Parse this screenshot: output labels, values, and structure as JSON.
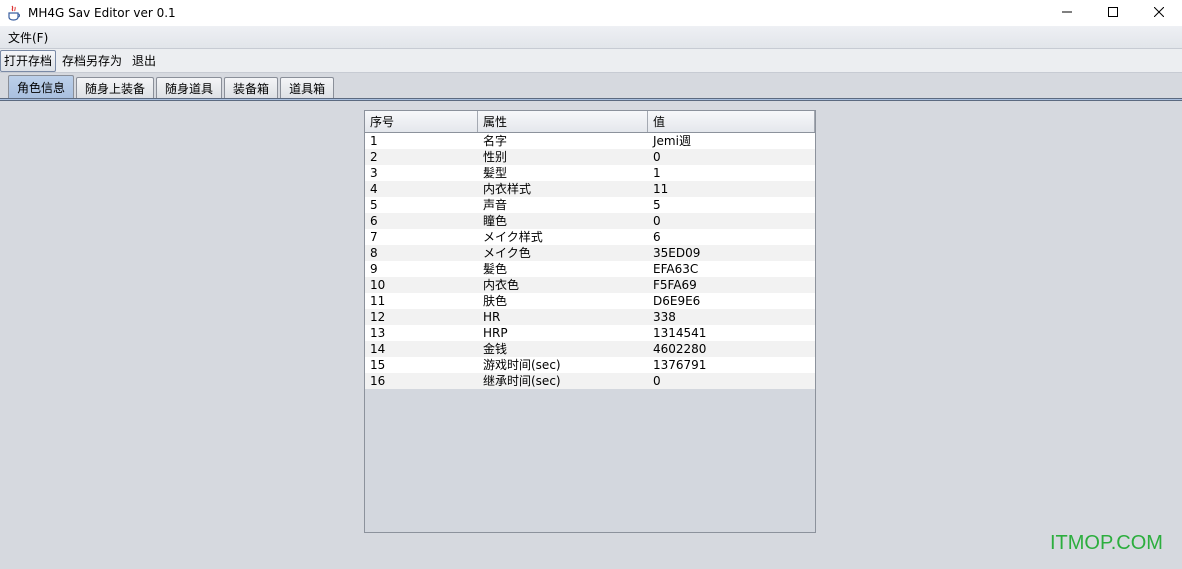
{
  "window": {
    "title": "MH4G Sav Editor ver 0.1",
    "controls": {
      "minimize": "—",
      "maximize": "☐",
      "close": "✕"
    }
  },
  "menubar": {
    "file": "文件(F)"
  },
  "toolbar": {
    "open": "打开存档",
    "save_as": "存档另存为",
    "exit": "退出"
  },
  "tabs": [
    "角色信息",
    "随身上装备",
    "随身道具",
    "装备箱",
    "道具箱"
  ],
  "table": {
    "headers": [
      "序号",
      "属性",
      "值"
    ],
    "rows": [
      [
        "1",
        "名字",
        "Jemi週"
      ],
      [
        "2",
        "性别",
        "0"
      ],
      [
        "3",
        "髪型",
        "1"
      ],
      [
        "4",
        "内衣样式",
        "11"
      ],
      [
        "5",
        "声音",
        "5"
      ],
      [
        "6",
        "瞳色",
        "0"
      ],
      [
        "7",
        "メイク样式",
        "6"
      ],
      [
        "8",
        "メイク色",
        "35ED09"
      ],
      [
        "9",
        "髪色",
        "EFA63C"
      ],
      [
        "10",
        "内衣色",
        "F5FA69"
      ],
      [
        "11",
        "肤色",
        "D6E9E6"
      ],
      [
        "12",
        "HR",
        "338"
      ],
      [
        "13",
        "HRP",
        "1314541"
      ],
      [
        "14",
        "金钱",
        "4602280"
      ],
      [
        "15",
        "游戏时间(sec)",
        "1376791"
      ],
      [
        "16",
        "继承时间(sec)",
        "0"
      ]
    ]
  },
  "watermark": "ITMOP.COM"
}
